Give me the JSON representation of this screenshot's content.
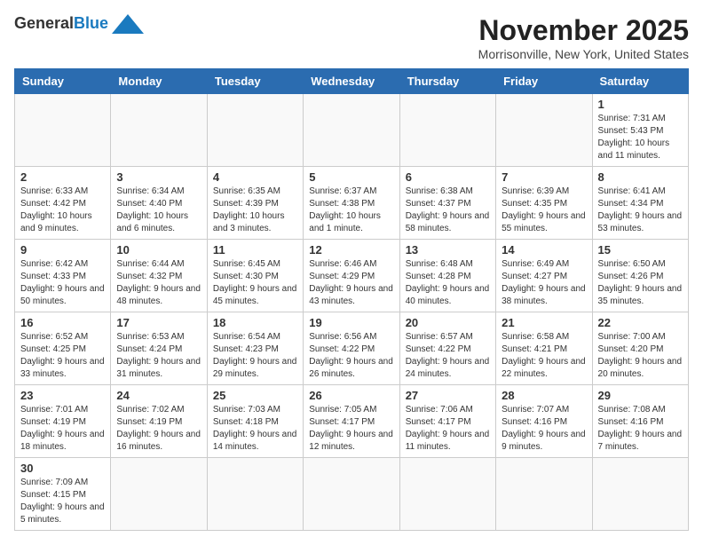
{
  "header": {
    "logo_general": "General",
    "logo_blue": "Blue",
    "month_title": "November 2025",
    "location": "Morrisonville, New York, United States"
  },
  "days_of_week": [
    "Sunday",
    "Monday",
    "Tuesday",
    "Wednesday",
    "Thursday",
    "Friday",
    "Saturday"
  ],
  "weeks": [
    [
      {
        "day": "",
        "info": ""
      },
      {
        "day": "",
        "info": ""
      },
      {
        "day": "",
        "info": ""
      },
      {
        "day": "",
        "info": ""
      },
      {
        "day": "",
        "info": ""
      },
      {
        "day": "",
        "info": ""
      },
      {
        "day": "1",
        "info": "Sunrise: 7:31 AM\nSunset: 5:43 PM\nDaylight: 10 hours and 11 minutes."
      }
    ],
    [
      {
        "day": "2",
        "info": "Sunrise: 6:33 AM\nSunset: 4:42 PM\nDaylight: 10 hours and 9 minutes."
      },
      {
        "day": "3",
        "info": "Sunrise: 6:34 AM\nSunset: 4:40 PM\nDaylight: 10 hours and 6 minutes."
      },
      {
        "day": "4",
        "info": "Sunrise: 6:35 AM\nSunset: 4:39 PM\nDaylight: 10 hours and 3 minutes."
      },
      {
        "day": "5",
        "info": "Sunrise: 6:37 AM\nSunset: 4:38 PM\nDaylight: 10 hours and 1 minute."
      },
      {
        "day": "6",
        "info": "Sunrise: 6:38 AM\nSunset: 4:37 PM\nDaylight: 9 hours and 58 minutes."
      },
      {
        "day": "7",
        "info": "Sunrise: 6:39 AM\nSunset: 4:35 PM\nDaylight: 9 hours and 55 minutes."
      },
      {
        "day": "8",
        "info": "Sunrise: 6:41 AM\nSunset: 4:34 PM\nDaylight: 9 hours and 53 minutes."
      }
    ],
    [
      {
        "day": "9",
        "info": "Sunrise: 6:42 AM\nSunset: 4:33 PM\nDaylight: 9 hours and 50 minutes."
      },
      {
        "day": "10",
        "info": "Sunrise: 6:44 AM\nSunset: 4:32 PM\nDaylight: 9 hours and 48 minutes."
      },
      {
        "day": "11",
        "info": "Sunrise: 6:45 AM\nSunset: 4:30 PM\nDaylight: 9 hours and 45 minutes."
      },
      {
        "day": "12",
        "info": "Sunrise: 6:46 AM\nSunset: 4:29 PM\nDaylight: 9 hours and 43 minutes."
      },
      {
        "day": "13",
        "info": "Sunrise: 6:48 AM\nSunset: 4:28 PM\nDaylight: 9 hours and 40 minutes."
      },
      {
        "day": "14",
        "info": "Sunrise: 6:49 AM\nSunset: 4:27 PM\nDaylight: 9 hours and 38 minutes."
      },
      {
        "day": "15",
        "info": "Sunrise: 6:50 AM\nSunset: 4:26 PM\nDaylight: 9 hours and 35 minutes."
      }
    ],
    [
      {
        "day": "16",
        "info": "Sunrise: 6:52 AM\nSunset: 4:25 PM\nDaylight: 9 hours and 33 minutes."
      },
      {
        "day": "17",
        "info": "Sunrise: 6:53 AM\nSunset: 4:24 PM\nDaylight: 9 hours and 31 minutes."
      },
      {
        "day": "18",
        "info": "Sunrise: 6:54 AM\nSunset: 4:23 PM\nDaylight: 9 hours and 29 minutes."
      },
      {
        "day": "19",
        "info": "Sunrise: 6:56 AM\nSunset: 4:22 PM\nDaylight: 9 hours and 26 minutes."
      },
      {
        "day": "20",
        "info": "Sunrise: 6:57 AM\nSunset: 4:22 PM\nDaylight: 9 hours and 24 minutes."
      },
      {
        "day": "21",
        "info": "Sunrise: 6:58 AM\nSunset: 4:21 PM\nDaylight: 9 hours and 22 minutes."
      },
      {
        "day": "22",
        "info": "Sunrise: 7:00 AM\nSunset: 4:20 PM\nDaylight: 9 hours and 20 minutes."
      }
    ],
    [
      {
        "day": "23",
        "info": "Sunrise: 7:01 AM\nSunset: 4:19 PM\nDaylight: 9 hours and 18 minutes."
      },
      {
        "day": "24",
        "info": "Sunrise: 7:02 AM\nSunset: 4:19 PM\nDaylight: 9 hours and 16 minutes."
      },
      {
        "day": "25",
        "info": "Sunrise: 7:03 AM\nSunset: 4:18 PM\nDaylight: 9 hours and 14 minutes."
      },
      {
        "day": "26",
        "info": "Sunrise: 7:05 AM\nSunset: 4:17 PM\nDaylight: 9 hours and 12 minutes."
      },
      {
        "day": "27",
        "info": "Sunrise: 7:06 AM\nSunset: 4:17 PM\nDaylight: 9 hours and 11 minutes."
      },
      {
        "day": "28",
        "info": "Sunrise: 7:07 AM\nSunset: 4:16 PM\nDaylight: 9 hours and 9 minutes."
      },
      {
        "day": "29",
        "info": "Sunrise: 7:08 AM\nSunset: 4:16 PM\nDaylight: 9 hours and 7 minutes."
      }
    ],
    [
      {
        "day": "30",
        "info": "Sunrise: 7:09 AM\nSunset: 4:15 PM\nDaylight: 9 hours and 5 minutes."
      },
      {
        "day": "",
        "info": ""
      },
      {
        "day": "",
        "info": ""
      },
      {
        "day": "",
        "info": ""
      },
      {
        "day": "",
        "info": ""
      },
      {
        "day": "",
        "info": ""
      },
      {
        "day": "",
        "info": ""
      }
    ]
  ]
}
